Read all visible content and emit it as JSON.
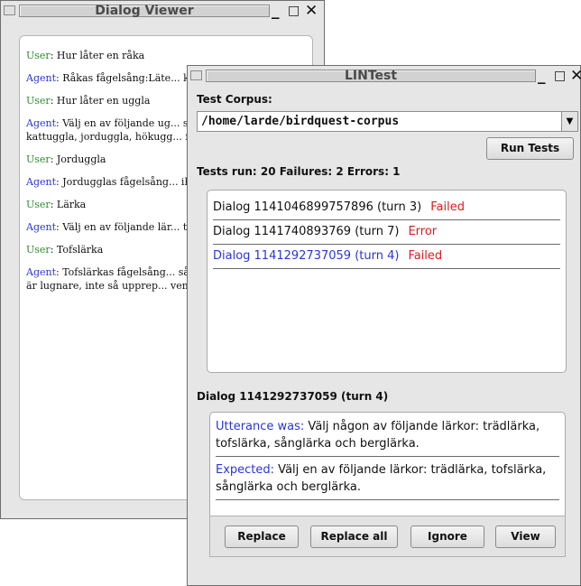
{
  "dialog_viewer": {
    "title": "Dialog Viewer",
    "controls": {
      "minimize": "_",
      "maximize": "□",
      "close": "✕"
    },
    "messages": [
      {
        "speaker": "User",
        "text": ": Hur låter en råka"
      },
      {
        "speaker": "Agent",
        "text": ": Råkas fågelsång:Läte... kråkans men är hesare och gr..."
      },
      {
        "speaker": "User",
        "text": ": Hur låter en uggla"
      },
      {
        "speaker": "Agent",
        "text": ": Välj en av följande ug... slaguggla, pärluggla, minerv... kattuggla, jorduggla, hökugg... fjälluggla och berguv."
      },
      {
        "speaker": "User",
        "text": ": Jorduggla"
      },
      {
        "speaker": "Agent",
        "text": ": Jordugglas fågelsång... ihåligt poande boo-boo-boo-..."
      },
      {
        "speaker": "User",
        "text": ": Lärka"
      },
      {
        "speaker": "Agent",
        "text": ": Välj en av följande lär... tofslärka, sånglärka och berg..."
      },
      {
        "speaker": "User",
        "text": ": Tofslärka"
      },
      {
        "speaker": "Agent",
        "text": ": Tofslärkas fågelsång... sång som påminner något om... den är lugnare, inte så upprep... vemodig, med strofer som t e..."
      }
    ]
  },
  "lintest": {
    "title": "LINTest",
    "controls": {
      "minimize": "_",
      "maximize": "□",
      "close": "✕"
    },
    "corpus_label": "Test Corpus:",
    "corpus_value": "/home/larde/birdquest-corpus",
    "run_button": "Run Tests",
    "summary": "Tests run: 20 Failures: 2 Errors: 1",
    "results": [
      {
        "name": "Dialog 1141046899757896 (turn 3)",
        "status": "Failed",
        "selected": false
      },
      {
        "name": "Dialog 1141740893769 (turn 7)",
        "status": "Error",
        "selected": false
      },
      {
        "name": "Dialog 1141292737059 (turn 4)",
        "status": "Failed",
        "selected": true
      }
    ],
    "detail_title": "Dialog 1141292737059 (turn 4)",
    "utterance_label": "Utterance was:",
    "utterance_text": " Välj någon av följande lärkor: trädlärka, tofslärka, sånglärka och berglärka.",
    "expected_label": "Expected:",
    "expected_text": " Välj en av följande lärkor: trädlärka, tofslärka, sånglärka och berglärka.",
    "buttons": {
      "replace": "Replace",
      "replace_all": "Replace all",
      "ignore": "Ignore",
      "view": "View"
    }
  }
}
